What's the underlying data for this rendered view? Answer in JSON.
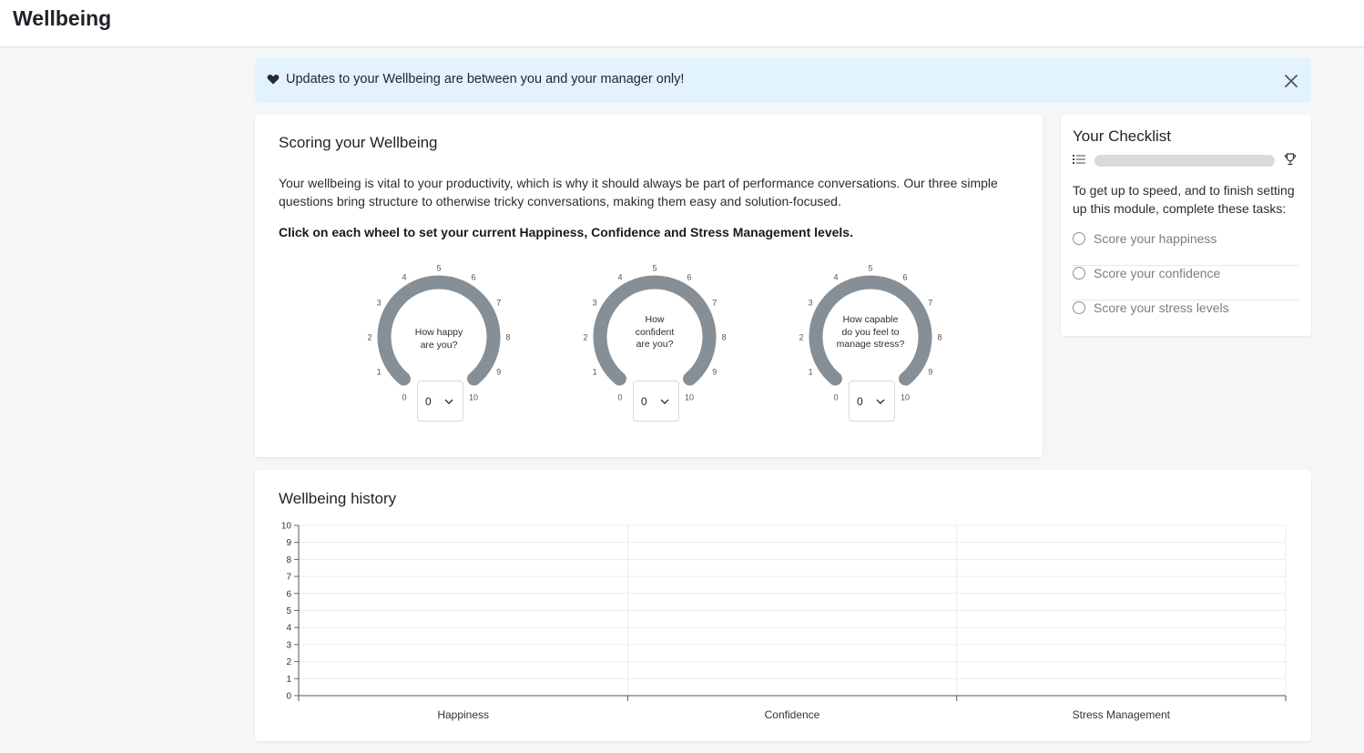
{
  "header": {
    "title": "Wellbeing"
  },
  "banner": {
    "message": "Updates to your Wellbeing are between you and your manager only!",
    "icon": "heart-icon",
    "close_icon": "close-icon"
  },
  "scoring": {
    "title": "Scoring your Wellbeing",
    "intro": "Your wellbeing is vital to your productivity, which is why it should always be part of performance conversations. Our three simple questions bring structure to otherwise tricky conversations, making them easy and solution-focused.",
    "instruction": "Click on each wheel to set your current Happiness, Confidence and Stress Management levels.",
    "gauge_color": "#868e96",
    "gauges": [
      {
        "question_lines": [
          "How happy",
          "are you?"
        ],
        "value": "0",
        "scale": [
          "0",
          "1",
          "2",
          "3",
          "4",
          "5",
          "6",
          "7",
          "8",
          "9",
          "10"
        ]
      },
      {
        "question_lines": [
          "How",
          "confident",
          "are you?"
        ],
        "value": "0",
        "scale": [
          "0",
          "1",
          "2",
          "3",
          "4",
          "5",
          "6",
          "7",
          "8",
          "9",
          "10"
        ]
      },
      {
        "question_lines": [
          "How capable",
          "do you feel to",
          "manage stress?"
        ],
        "value": "0",
        "scale": [
          "0",
          "1",
          "2",
          "3",
          "4",
          "5",
          "6",
          "7",
          "8",
          "9",
          "10"
        ]
      }
    ]
  },
  "checklist": {
    "title": "Your Checklist",
    "progress": 0,
    "description": "To get up to speed, and to finish setting up this module, complete these tasks:",
    "tasks": [
      {
        "label": "Score your happiness",
        "done": false
      },
      {
        "label": "Score your confidence",
        "done": false
      },
      {
        "label": "Score your stress levels",
        "done": false
      }
    ]
  },
  "history": {
    "title": "Wellbeing history"
  },
  "chart_data": {
    "type": "bar",
    "title": "Wellbeing history",
    "categories": [
      "Happiness",
      "Confidence",
      "Stress Management"
    ],
    "values": [
      0,
      0,
      0
    ],
    "ylim": [
      0,
      10
    ],
    "yticks": [
      "0",
      "1",
      "2",
      "3",
      "4",
      "5",
      "6",
      "7",
      "8",
      "9",
      "10"
    ],
    "xlabel": "",
    "ylabel": "",
    "grid": true
  }
}
